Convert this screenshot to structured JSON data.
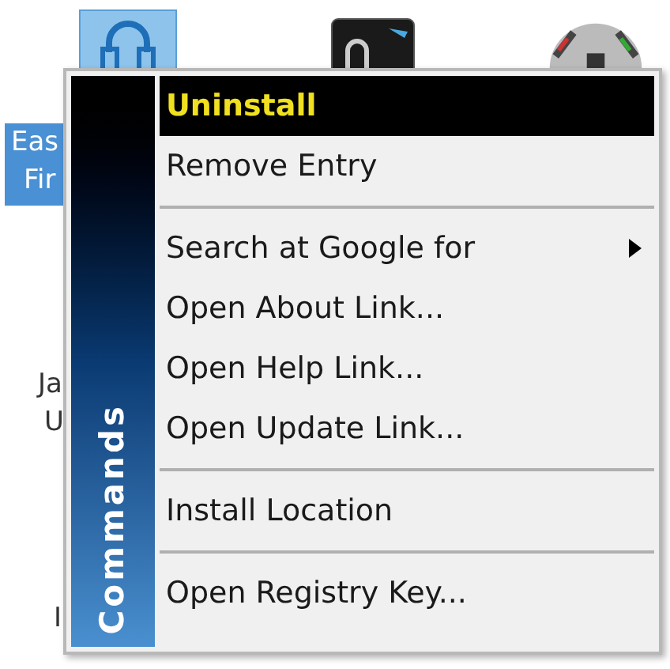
{
  "background": {
    "items": [
      {
        "kind": "headset",
        "selected": true,
        "label_lines": [
          "Eas",
          "Fir"
        ]
      },
      {
        "kind": "device",
        "selected": false
      },
      {
        "kind": "ball",
        "selected": false
      }
    ],
    "partial_labels": [
      "Ja",
      "U",
      "I"
    ]
  },
  "menu": {
    "title": "Commands",
    "items": [
      {
        "kind": "item",
        "label": "Uninstall",
        "selected": true
      },
      {
        "kind": "item",
        "label": "Remove Entry",
        "selected": false
      },
      {
        "kind": "separator"
      },
      {
        "kind": "submenu",
        "label": "Search at Google for",
        "selected": false
      },
      {
        "kind": "item",
        "label": "Open About Link...",
        "selected": false
      },
      {
        "kind": "item",
        "label": "Open Help Link...",
        "selected": false
      },
      {
        "kind": "item",
        "label": "Open Update Link...",
        "selected": false
      },
      {
        "kind": "separator"
      },
      {
        "kind": "item",
        "label": "Install Location",
        "selected": false
      },
      {
        "kind": "separator"
      },
      {
        "kind": "item",
        "label": "Open Registry Key...",
        "selected": false
      }
    ]
  }
}
